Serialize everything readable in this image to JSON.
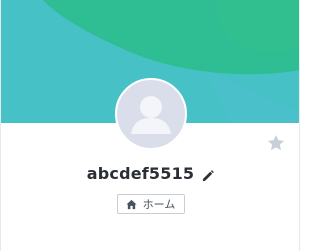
{
  "profile": {
    "username": "abcdef5515",
    "home_label": "ホーム"
  },
  "colors": {
    "banner_teal": "#46c2c7",
    "banner_green": "#2fbd94",
    "avatar_bg": "#d9deea",
    "avatar_figure": "#f3f5fa",
    "star": "#c9cfd9",
    "text": "#2a2f36"
  },
  "icons": {
    "avatar": "person-silhouette",
    "favorite": "star-icon",
    "edit": "pencil-icon",
    "home": "home-icon"
  }
}
